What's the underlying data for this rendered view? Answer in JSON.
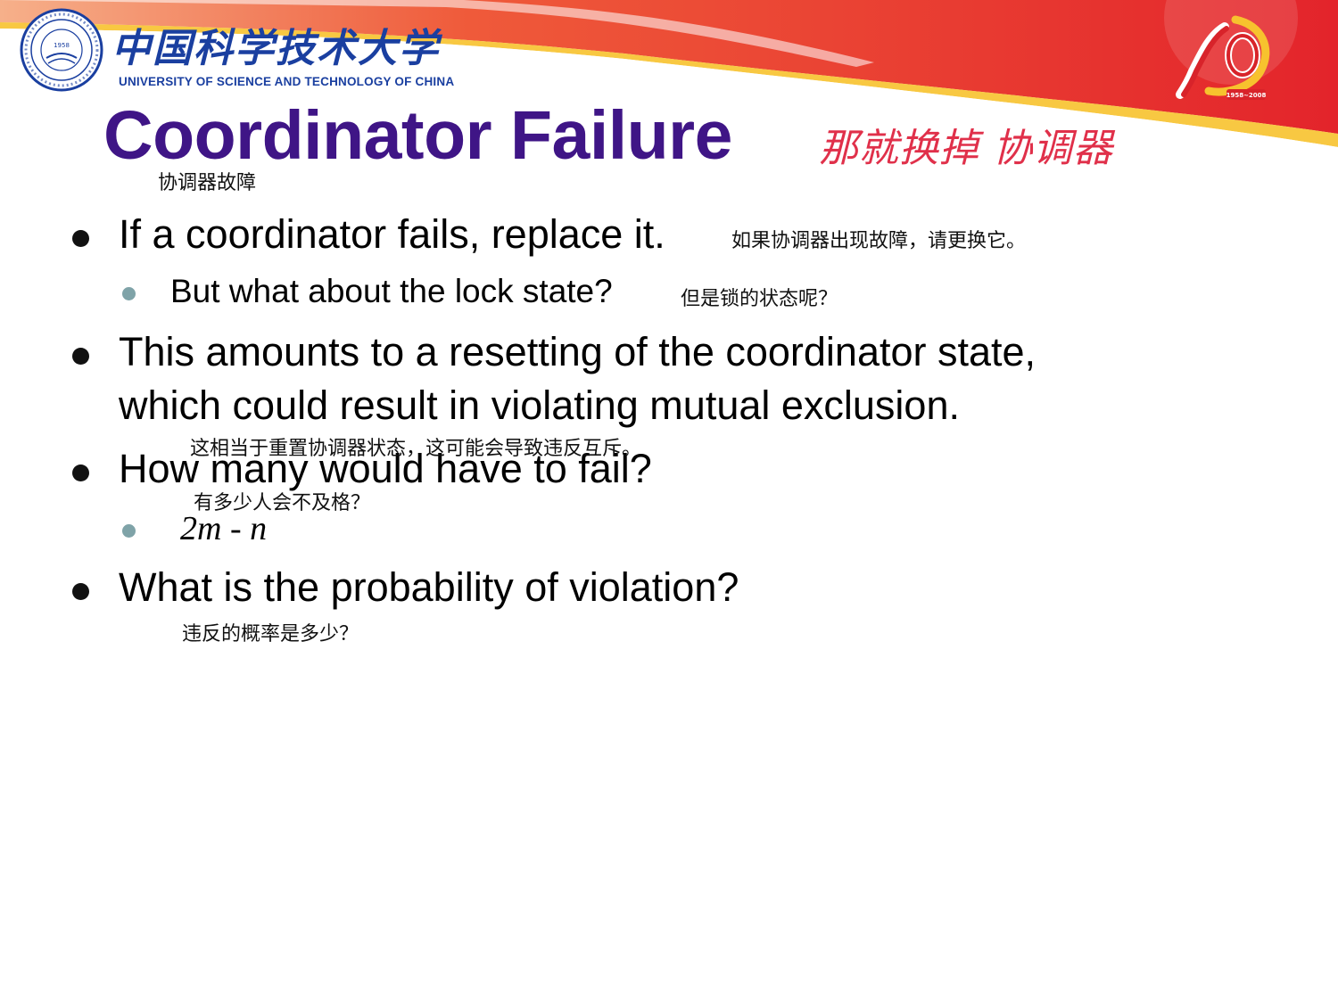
{
  "header": {
    "university_cn": "中国科学技术大学",
    "university_en": "UNIVERSITY OF SCIENCE AND TECHNOLOGY OF CHINA",
    "seal_year": "1958",
    "anniversary_years": "1958~2008",
    "colors": {
      "brand_blue": "#1a3fa0",
      "banner_red": "#e3242b",
      "banner_yellow": "#f7c22e"
    }
  },
  "slide": {
    "title": "Coordinator Failure",
    "title_cn": "协调器故障",
    "handwritten_note": "那就换掉 协调器",
    "title_color": "#3f1586",
    "bullets": [
      {
        "text": "If a coordinator fails, replace it.",
        "cn": "如果协调器出现故障，请更换它。"
      },
      {
        "text": "But what about the lock state?",
        "cn": "但是锁的状态呢？"
      },
      {
        "line1": "This amounts to a resetting of the coordinator state,",
        "line2": "which could result in violating mutual exclusion.",
        "cn": "这相当于重置协调器状态，这可能会导致违反互斥。"
      },
      {
        "text": "How many would have to fail?",
        "cn": "有多少人会不及格？"
      },
      {
        "text": "2m - n"
      },
      {
        "text": "What is the probability of violation?",
        "cn": "违反的概率是多少？"
      }
    ]
  }
}
